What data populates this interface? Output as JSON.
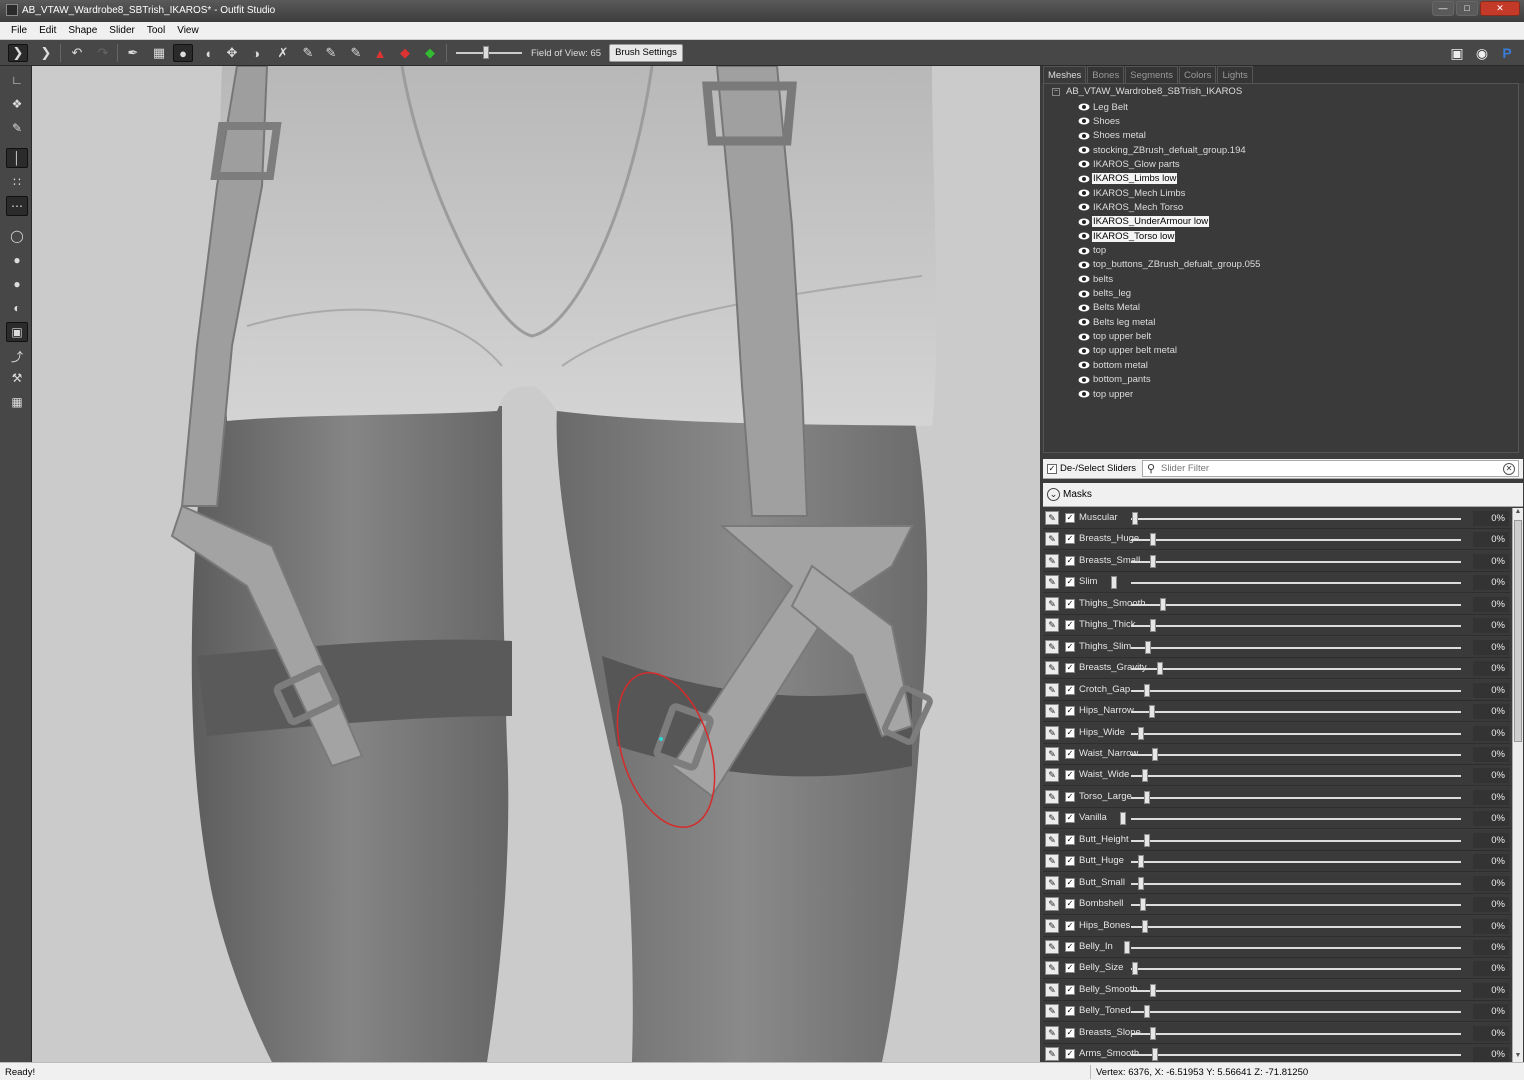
{
  "window": {
    "title": "AB_VTAW_Wardrobe8_SBTrish_IKAROS* - Outfit Studio"
  },
  "menu": [
    "File",
    "Edit",
    "Shape",
    "Slider",
    "Tool",
    "View"
  ],
  "toolbar": {
    "fov_label": "Field of View: 65",
    "fov_value": 65,
    "brush_settings_label": "Brush Settings"
  },
  "mesh_tabs": [
    "Meshes",
    "Bones",
    "Segments",
    "Colors",
    "Lights"
  ],
  "mesh_tree": {
    "root": "AB_VTAW_Wardrobe8_SBTrish_IKAROS",
    "items": [
      {
        "label": "Leg Belt",
        "selected": false
      },
      {
        "label": "Shoes",
        "selected": false
      },
      {
        "label": "Shoes metal",
        "selected": false
      },
      {
        "label": "stocking_ZBrush_defualt_group.194",
        "selected": false
      },
      {
        "label": "IKAROS_Glow parts",
        "selected": false
      },
      {
        "label": "IKAROS_Limbs low",
        "selected": true
      },
      {
        "label": "IKAROS_Mech Limbs",
        "selected": false
      },
      {
        "label": "IKAROS_Mech Torso",
        "selected": false
      },
      {
        "label": "IKAROS_UnderArmour low",
        "selected": true
      },
      {
        "label": "IKAROS_Torso low",
        "selected": true
      },
      {
        "label": "top",
        "selected": false
      },
      {
        "label": "top_buttons_ZBrush_defualt_group.055",
        "selected": false
      },
      {
        "label": "belts",
        "selected": false
      },
      {
        "label": "belts_leg",
        "selected": false
      },
      {
        "label": "Belts Metal",
        "selected": false
      },
      {
        "label": "Belts leg metal",
        "selected": false
      },
      {
        "label": "top upper belt",
        "selected": false
      },
      {
        "label": "top upper belt metal",
        "selected": false
      },
      {
        "label": "bottom metal",
        "selected": false
      },
      {
        "label": "bottom_pants",
        "selected": false
      },
      {
        "label": "top upper",
        "selected": false
      }
    ]
  },
  "slider_panel": {
    "deselect_label": "De-/Select Sliders",
    "filter_placeholder": "Slider Filter",
    "masks_label": "Masks",
    "sliders": [
      {
        "name": "Muscular",
        "value": "0%",
        "pos": 0.0
      },
      {
        "name": "Breasts_Huge",
        "value": "0%",
        "pos": 0.055
      },
      {
        "name": "Breasts_Small",
        "value": "0%",
        "pos": 0.055
      },
      {
        "name": "Slim",
        "value": "0%",
        "pos": -0.065
      },
      {
        "name": "Thighs_Smooth",
        "value": "0%",
        "pos": 0.085
      },
      {
        "name": "Thighs_Thick",
        "value": "0%",
        "pos": 0.055
      },
      {
        "name": "Thighs_Slim",
        "value": "0%",
        "pos": 0.04
      },
      {
        "name": "Breasts_Gravity",
        "value": "0%",
        "pos": 0.075
      },
      {
        "name": "Crotch_Gap",
        "value": "0%",
        "pos": 0.035
      },
      {
        "name": "Hips_Narrow",
        "value": "0%",
        "pos": 0.05
      },
      {
        "name": "Hips_Wide",
        "value": "0%",
        "pos": 0.018
      },
      {
        "name": "Waist_Narrow",
        "value": "0%",
        "pos": 0.06
      },
      {
        "name": "Waist_Wide",
        "value": "0%",
        "pos": 0.03
      },
      {
        "name": "Torso_Large",
        "value": "0%",
        "pos": 0.035
      },
      {
        "name": "Vanilla",
        "value": "0%",
        "pos": -0.035
      },
      {
        "name": "Butt_Height",
        "value": "0%",
        "pos": 0.035
      },
      {
        "name": "Butt_Huge",
        "value": "0%",
        "pos": 0.018
      },
      {
        "name": "Butt_Small",
        "value": "0%",
        "pos": 0.018
      },
      {
        "name": "Bombshell",
        "value": "0%",
        "pos": 0.025
      },
      {
        "name": "Hips_Bones",
        "value": "0%",
        "pos": 0.03
      },
      {
        "name": "Belly_In",
        "value": "0%",
        "pos": -0.025
      },
      {
        "name": "Belly_Size",
        "value": "0%",
        "pos": 0.0
      },
      {
        "name": "Belly_Smooth",
        "value": "0%",
        "pos": 0.055
      },
      {
        "name": "Belly_Toned",
        "value": "0%",
        "pos": 0.035
      },
      {
        "name": "Breasts_Slope",
        "value": "0%",
        "pos": 0.055
      },
      {
        "name": "Arms_Smooth",
        "value": "0%",
        "pos": 0.06
      }
    ]
  },
  "status": {
    "left": "Ready!",
    "right": "Vertex: 6376, X: -6.51953 Y: 5.56641 Z: -71.81250"
  }
}
